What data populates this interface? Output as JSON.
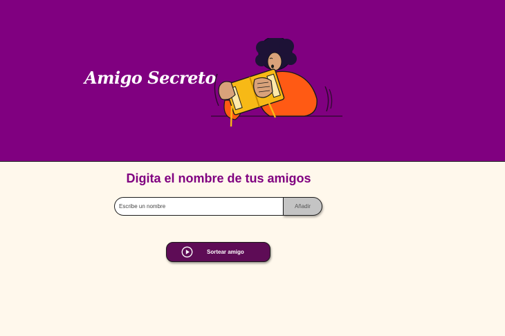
{
  "header": {
    "title": "Amigo Secreto",
    "background_color": "#800080",
    "illustration": "person-holding-gift-illustration"
  },
  "main": {
    "subtitle": "Digita el nombre de tus amigos",
    "input": {
      "placeholder": "Escribe un nombre",
      "value": ""
    },
    "add_button_label": "Añadir",
    "draw_button": {
      "label": "Sortear amigo",
      "icon": "play-icon"
    },
    "accent_color": "#800080",
    "page_background": "#FFF8EC"
  }
}
